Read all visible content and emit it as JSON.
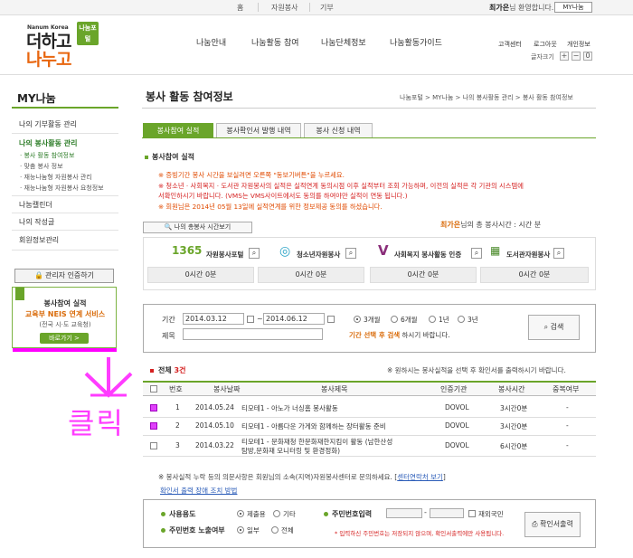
{
  "topbar": {
    "links": [
      "홈",
      "자원봉사",
      "기부"
    ],
    "welcome_name": "최가은",
    "welcome_suffix": "님 환영합니다.",
    "my_button": "MY나눔"
  },
  "logo": {
    "small_text": "Nanum Korea",
    "main_line1": "더하고",
    "main_line2": "나누고",
    "badge": "나눔포털"
  },
  "gnb": {
    "items": [
      "나눔안내",
      "나눔활동 참여",
      "나눔단체정보",
      "나눔활동가이드"
    ],
    "util": [
      "고객센터",
      "로그아웃",
      "개인정보"
    ],
    "fontsize_label": "글자크기",
    "fontsize_buttons": [
      "+",
      "−",
      "0"
    ]
  },
  "sidebar": {
    "title": "MY나눔",
    "menu": [
      {
        "label": "나의 기부활동 관리"
      },
      {
        "label": "나의 봉사활동 관리"
      },
      {
        "label": "나눔캘린더"
      },
      {
        "label": "나의 작성글"
      },
      {
        "label": "회원정보관리"
      }
    ],
    "submenu": [
      "· 봉사 활동 참여정보",
      "· 맞춤 봉사 정보",
      "· 재능나눔형 자원봉사 관리",
      "· 재능나눔형 자원봉사 요청정보"
    ],
    "cert_button": "관리자 인증하기",
    "neis": {
      "title": "봉사참여 실적",
      "subtitle": "교육부 NEIS 연계 서비스",
      "desc": "(전국 시·도 교육청)",
      "button": "바로가기 >"
    }
  },
  "page": {
    "title": "봉사 활동 참여정보",
    "breadcrumb": "나눔포털 > MY나눔 > 나의 봉사활동 관리 > 봉사 활동 참여정보",
    "tabs": [
      "봉사참여 실적",
      "봉사확인서 발행 내역",
      "봉사 신청 내역"
    ],
    "section_title": "봉사참여 실적",
    "notices": [
      "※ 증빙기간 봉사 시간을 보실려면 오른쪽 \"동보기버튼\"을 누르세요.",
      "※ 청소년 · 사회복지 · 도서관 자원봉사의 실적은 실적연계 동의시점 이후 실적부터 조회 가능하며, 이전의 실적은 각 기관의 시스템에",
      "서확인하시기 바랍니다. (VMS는 VMS사이트에서도 동의를 하여야만 실적이 연동 됩니다.)",
      "※ 회원님은 2014년 05월 13일에 실적연계를 위한 정보제공 동의를 하셨습니다."
    ],
    "total_hours_button": "나의 총봉사 시간보기",
    "total_hours_name": "최가은",
    "total_hours_text": "님의 총 봉사시간 :",
    "total_hours_value": "시간 분"
  },
  "sources": [
    {
      "logo": "1365",
      "name": "자원봉사포털",
      "value": "0시간 0분"
    },
    {
      "logo": "◎",
      "name": "청소년자원봉사",
      "value": "0시간 0분"
    },
    {
      "logo": "V",
      "name": "사회복지 봉사활동 인증",
      "value": "0시간 0분"
    },
    {
      "logo": "▦",
      "name": "도서관자원봉사",
      "value": "0시간 0분"
    }
  ],
  "filter": {
    "period_label": "기간",
    "start_date": "2014.03.12",
    "end_date": "2014.06.12",
    "title_label": "제목",
    "title_value": "",
    "range_options": [
      "3개월",
      "6개월",
      "1년",
      "3년"
    ],
    "selected_range": "3개월",
    "hint_strong": "기간 선택 후 검색",
    "hint_rest": "하시기 바랍니다.",
    "search_button": "검색"
  },
  "table": {
    "total_label": "전체",
    "total_count": "3건",
    "hint": "※ 원하시는 봉사실적을 선택 후 확인서를 출력하시기 바랍니다.",
    "headers": [
      "번호",
      "봉사날짜",
      "봉사제목",
      "인증기관",
      "봉사시간",
      "중복여부"
    ],
    "rows": [
      {
        "no": "1",
        "date": "2014.05.24",
        "title": "티모테1 - 아노가 너싱홈 봉사활동",
        "org": "DOVOL",
        "hours": "3시간0분",
        "dup": "-"
      },
      {
        "no": "2",
        "date": "2014.05.10",
        "title": "티모테1 - 아름다운 가게와 함께하는 장터활동 준비",
        "org": "DOVOL",
        "hours": "3시간0분",
        "dup": "-"
      },
      {
        "no": "3",
        "date": "2014.03.22",
        "title_line1": "티모테1 - 문화재청 한문화재한지킴이 활동 (남한산성",
        "title_line2": "탐방,문화재 모니터링 및 환경정화)",
        "org": "DOVOL",
        "hours": "6시간0분",
        "dup": "-"
      }
    ]
  },
  "footnote": {
    "text": "※ 봉사실적 누락 등의 의문사항은 회원님의 소속(지역)자원봉사센터로 문의하세요. [",
    "link": "센터연락처 보기",
    "close": "]",
    "link2": "확인서 출력 장애 조치 방법"
  },
  "print_box": {
    "usage_label": "사용용도",
    "usage_options": [
      "제출용",
      "기타"
    ],
    "rrn_label": "주민번호입력",
    "foreigner_label": "재외국민",
    "rrn_expose_label": "주민번호 노출여부",
    "expose_options": [
      "일부",
      "전체"
    ],
    "rrn_hint": "* 입력하신 주민번호는 저장되지 않으며, 확인서출력에만 사용됩니다.",
    "print_button": "확인서출력"
  },
  "annotation": {
    "text": "클릭",
    "color": "#ff3cff"
  }
}
